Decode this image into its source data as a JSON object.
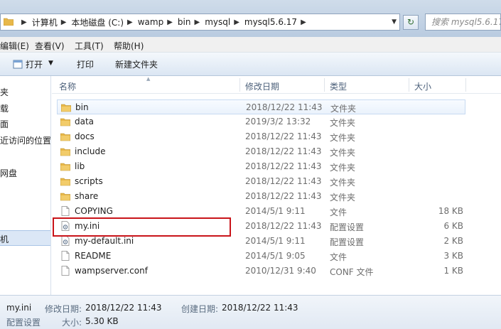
{
  "address": {
    "crumbs": [
      "计算机",
      "本地磁盘 (C:)",
      "wamp",
      "bin",
      "mysql",
      "mysql5.6.17"
    ],
    "search_placeholder": "搜索 mysql5.6.17"
  },
  "menu": [
    "编辑(E)",
    "查看(V)",
    "工具(T)",
    "帮助(H)"
  ],
  "toolbar": {
    "open": "打开",
    "print": "打印",
    "new_folder": "新建文件夹"
  },
  "nav": [
    "夹",
    "载",
    "面",
    "近访问的位置",
    "网盘",
    "机"
  ],
  "columns": {
    "name": "名称",
    "date": "修改日期",
    "type": "类型",
    "size": "大小"
  },
  "files": [
    {
      "name": "bin",
      "date": "2018/12/22 11:43",
      "type": "文件夹",
      "size": "",
      "icon": "folder-icon"
    },
    {
      "name": "data",
      "date": "2019/3/2 13:32",
      "type": "文件夹",
      "size": "",
      "icon": "folder-icon"
    },
    {
      "name": "docs",
      "date": "2018/12/22 11:43",
      "type": "文件夹",
      "size": "",
      "icon": "folder-icon"
    },
    {
      "name": "include",
      "date": "2018/12/22 11:43",
      "type": "文件夹",
      "size": "",
      "icon": "folder-icon"
    },
    {
      "name": "lib",
      "date": "2018/12/22 11:43",
      "type": "文件夹",
      "size": "",
      "icon": "folder-icon"
    },
    {
      "name": "scripts",
      "date": "2018/12/22 11:43",
      "type": "文件夹",
      "size": "",
      "icon": "folder-icon"
    },
    {
      "name": "share",
      "date": "2018/12/22 11:43",
      "type": "文件夹",
      "size": "",
      "icon": "folder-icon"
    },
    {
      "name": "COPYING",
      "date": "2014/5/1 9:11",
      "type": "文件",
      "size": "18 KB",
      "icon": "file-icon"
    },
    {
      "name": "my.ini",
      "date": "2018/12/22 11:43",
      "type": "配置设置",
      "size": "6 KB",
      "icon": "config-file-icon"
    },
    {
      "name": "my-default.ini",
      "date": "2014/5/1 9:11",
      "type": "配置设置",
      "size": "2 KB",
      "icon": "config-file-icon"
    },
    {
      "name": "README",
      "date": "2014/5/1 9:05",
      "type": "文件",
      "size": "3 KB",
      "icon": "file-icon"
    },
    {
      "name": "wampserver.conf",
      "date": "2010/12/31 9:40",
      "type": "CONF 文件",
      "size": "1 KB",
      "icon": "file-icon"
    }
  ],
  "status": {
    "name": "my.ini",
    "modified_label": "修改日期:",
    "modified": "2018/12/22 11:43",
    "created_label": "创建日期:",
    "created": "2018/12/22 11:43",
    "type": "配置设置",
    "size_label": "大小:",
    "size": "5.30 KB"
  },
  "colors": {
    "highlight_border": "#c9141a",
    "folder": "#e8b84a"
  }
}
